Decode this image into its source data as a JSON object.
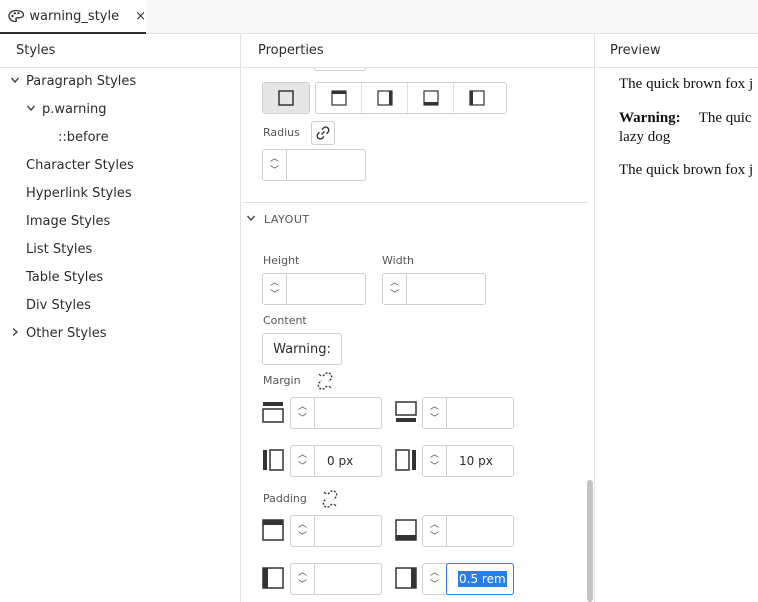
{
  "tab": {
    "title": "warning_style",
    "close": "×"
  },
  "panels": {
    "styles": "Styles",
    "properties": "Properties",
    "preview": "Preview"
  },
  "tree": {
    "paragraph_styles": "Paragraph Styles",
    "p_warning": "p.warning",
    "before": "::before",
    "character_styles": "Character Styles",
    "hyperlink_styles": "Hyperlink Styles",
    "image_styles": "Image Styles",
    "list_styles": "List Styles",
    "table_styles": "Table Styles",
    "div_styles": "Div Styles",
    "other_styles": "Other Styles"
  },
  "properties": {
    "radius_label": "Radius",
    "radius_value": "",
    "layout_section": "LAYOUT",
    "height_label": "Height",
    "height_value": "",
    "width_label": "Width",
    "width_value": "",
    "content_label": "Content",
    "content_value": "Warning:",
    "margin_label": "Margin",
    "margin_top": "",
    "margin_bottom": "",
    "margin_left": "0 px",
    "margin_right": "10 px",
    "padding_label": "Padding",
    "padding_top": "",
    "padding_bottom": "",
    "padding_left": "",
    "padding_right": "0.5 rem"
  },
  "preview": {
    "line1": "The quick brown fox j",
    "warning_label": "Warning:",
    "warning_text": "The quic",
    "line2_cont": "lazy dog",
    "line3": "The quick brown fox j"
  },
  "colors": {
    "accent": "#2680eb",
    "border": "#cfcfcf",
    "divider": "#e1e1e1"
  }
}
